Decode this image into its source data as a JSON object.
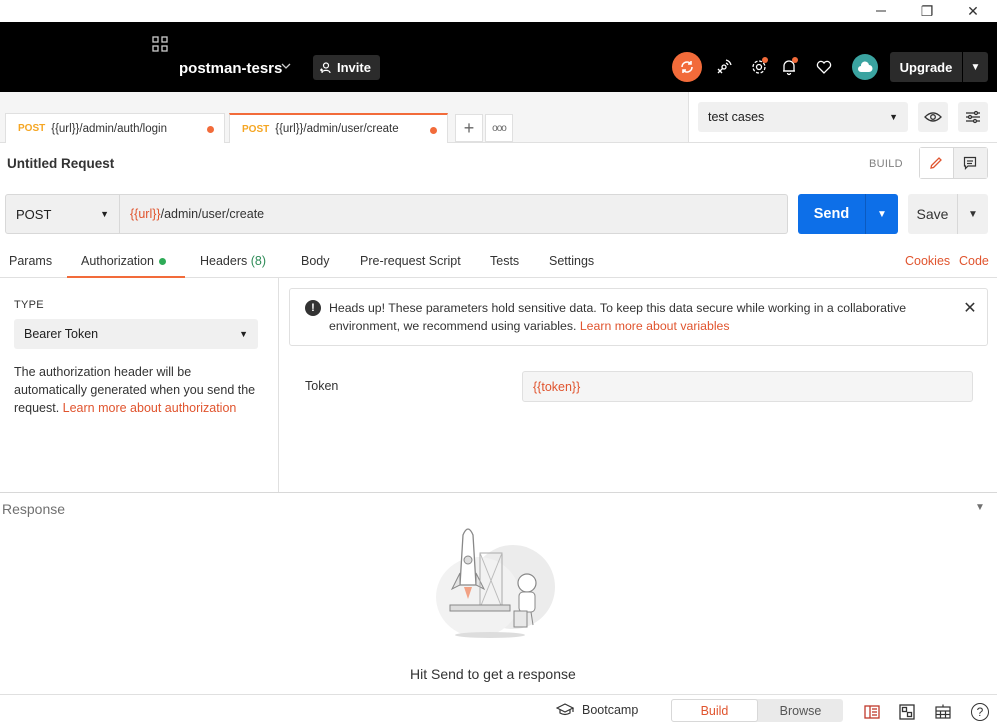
{
  "window": {
    "restore_glyph": "❐",
    "close_glyph": "✕"
  },
  "header": {
    "workspace_name": "postman-tesrs",
    "invite_label": "Invite",
    "upgrade_label": "Upgrade",
    "brand_color": "#f26b3a"
  },
  "tabs": [
    {
      "method": "POST",
      "url": "{{url}}/admin/auth/login",
      "unsaved": true,
      "active": false
    },
    {
      "method": "POST",
      "url": "{{url}}/admin/user/create",
      "unsaved": true,
      "active": true
    }
  ],
  "tab_controls": {
    "new_tab": "+",
    "more": "ooo"
  },
  "environment": {
    "selected": "test cases"
  },
  "request": {
    "title": "Untitled Request",
    "mode_label": "BUILD",
    "method": "POST",
    "url_var": "{{url}}",
    "url_path": "/admin/user/create",
    "send_label": "Send",
    "save_label": "Save"
  },
  "subtabs": {
    "params": "Params",
    "authorization": "Authorization",
    "headers": "Headers",
    "headers_count": "(8)",
    "body": "Body",
    "prerequest": "Pre-request Script",
    "tests": "Tests",
    "settings": "Settings",
    "cookies": "Cookies",
    "code": "Code"
  },
  "auth": {
    "type_label": "TYPE",
    "type_value": "Bearer Token",
    "desc": "The authorization header will be automatically generated when you send the request. ",
    "desc_link": "Learn more about authorization",
    "alert_text": "Heads up! These parameters hold sensitive data. To keep this data secure while working in a collaborative environment, we recommend using variables. ",
    "alert_link": "Learn more about variables",
    "token_label": "Token",
    "token_value": "{{token}}"
  },
  "response": {
    "title": "Response",
    "hint": "Hit Send to get a response"
  },
  "footer": {
    "bootcamp": "Bootcamp",
    "build": "Build",
    "browse": "Browse",
    "help": "?"
  }
}
